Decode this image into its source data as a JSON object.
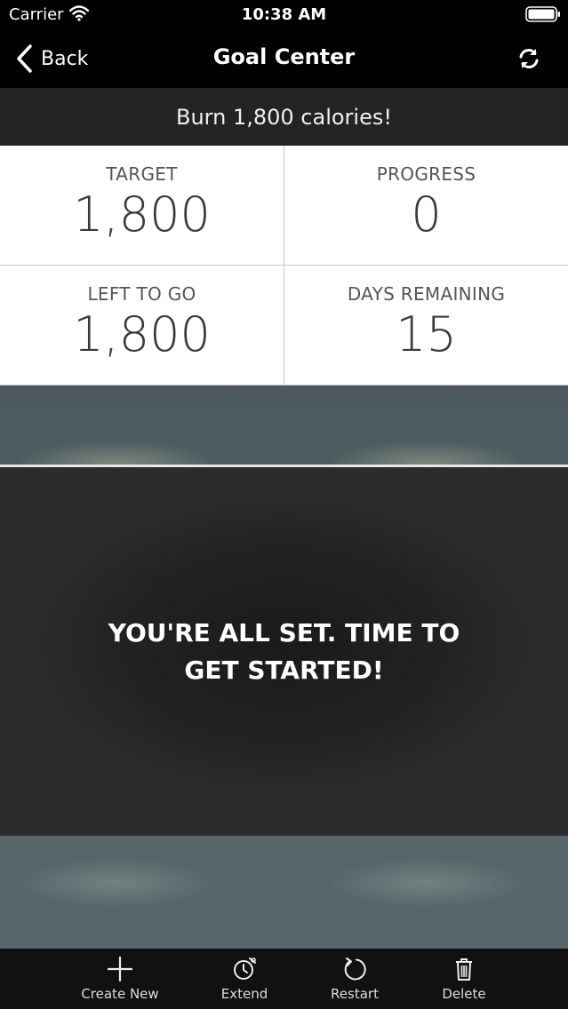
{
  "status_bar": {
    "carrier": "Carrier",
    "time": "10:38 AM"
  },
  "nav": {
    "back_label": "Back",
    "title": "Goal Center"
  },
  "goal_banner": "Burn 1,800 calories!",
  "stats": {
    "target": {
      "label": "TARGET",
      "value": "1,800"
    },
    "progress": {
      "label": "PROGRESS",
      "value": "0"
    },
    "left_to_go": {
      "label": "LEFT TO GO",
      "value": "1,800"
    },
    "days_remaining": {
      "label": "DAYS REMAINING",
      "value": "15"
    }
  },
  "message": "YOU'RE ALL SET. TIME TO GET STARTED!",
  "tab_bar": {
    "items": [
      {
        "label": "Create New",
        "icon": "plus-icon"
      },
      {
        "label": "Extend",
        "icon": "alarm-clock-icon"
      },
      {
        "label": "Restart",
        "icon": "restart-icon"
      },
      {
        "label": "Delete",
        "icon": "trash-icon"
      }
    ]
  }
}
